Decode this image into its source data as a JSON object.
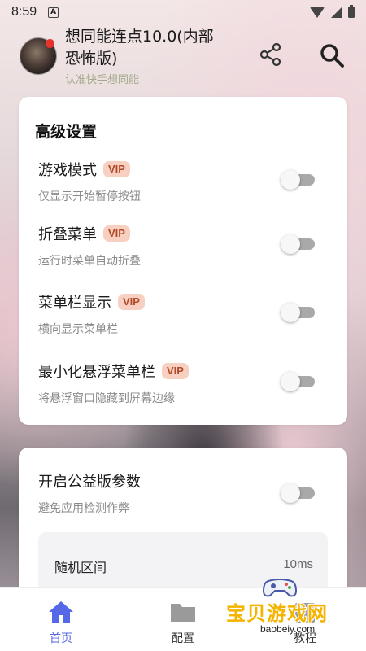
{
  "status_bar": {
    "time": "8:59",
    "notification_letter": "A"
  },
  "header": {
    "title": "想同能连点10.0(内部恐怖版)",
    "subtitle": "认准快手想同能",
    "share_icon": "share-icon",
    "search_icon": "search-icon"
  },
  "advanced": {
    "title": "高级设置",
    "items": [
      {
        "label": "游戏模式",
        "badge": "VIP",
        "desc": "仅显示开始暂停按钮",
        "enabled": false
      },
      {
        "label": "折叠菜单",
        "badge": "VIP",
        "desc": "运行时菜单自动折叠",
        "enabled": false
      },
      {
        "label": "菜单栏显示",
        "badge": "VIP",
        "desc": "横向显示菜单栏",
        "enabled": false
      },
      {
        "label": "最小化悬浮菜单栏",
        "badge": "VIP",
        "desc": "将悬浮窗口隐藏到屏幕边缘",
        "enabled": false
      }
    ]
  },
  "public": {
    "label": "开启公益版参数",
    "desc": "避免应用检测作弊",
    "enabled": false,
    "random_interval": {
      "label": "随机区间",
      "value": "10ms"
    }
  },
  "nav": {
    "items": [
      {
        "label": "首页",
        "icon": "home-icon",
        "active": true
      },
      {
        "label": "配置",
        "icon": "folder-icon",
        "active": false
      },
      {
        "label": "教程",
        "icon": "book-icon",
        "active": false
      }
    ]
  },
  "watermark": {
    "text": "宝贝游戏网",
    "url": "baobeiy.com"
  },
  "colors": {
    "accent": "#5568e8",
    "vip_bg": "#f7d0c1",
    "vip_text": "#b24a2a"
  }
}
